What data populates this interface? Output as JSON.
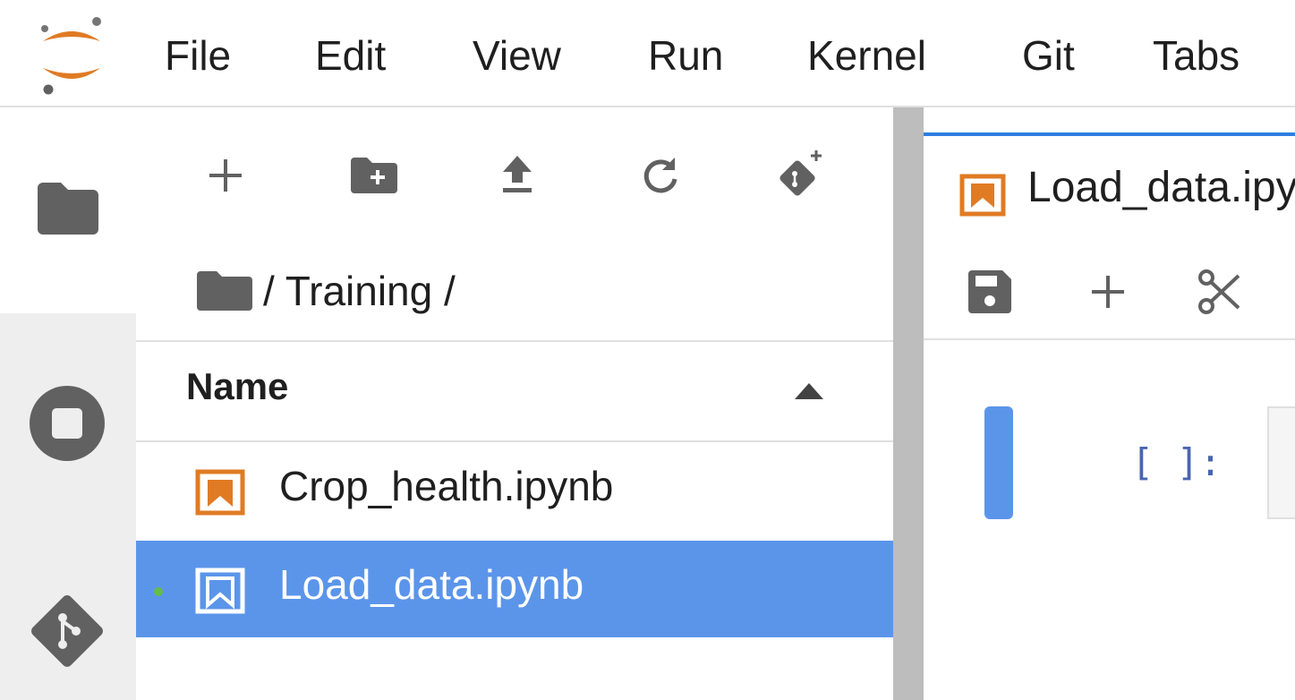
{
  "menubar": {
    "items": [
      "File",
      "Edit",
      "View",
      "Run",
      "Kernel",
      "Git",
      "Tabs"
    ]
  },
  "icons": {
    "logo": "jupyter-logo-icon",
    "files_tab": "folder-icon",
    "running_tab": "stop-circle-icon",
    "git_tab": "git-icon",
    "new_launcher": "plus-icon",
    "new_folder": "new-folder-icon",
    "upload": "upload-icon",
    "refresh": "refresh-icon",
    "git_clone": "git-clone-icon",
    "notebook": "notebook-icon",
    "save": "save-icon",
    "insert_cell": "plus-icon",
    "cut": "scissors-icon"
  },
  "filebrowser": {
    "breadcrumb": "/ Training /",
    "column_name": "Name",
    "sort": "ascending",
    "files": [
      {
        "name": "Crop_health.ipynb",
        "selected": false,
        "running": false
      },
      {
        "name": "Load_data.ipynb",
        "selected": true,
        "running": true
      }
    ]
  },
  "notebook": {
    "tab_label": "Load_data.ipynb",
    "cell_prompt": "[ ]:"
  },
  "colors": {
    "accent": "#2f7de1",
    "selection": "#5b95ea",
    "notebook_icon": "#e07b24",
    "running_dot": "#66bb4a",
    "icon_gray": "#616161"
  }
}
